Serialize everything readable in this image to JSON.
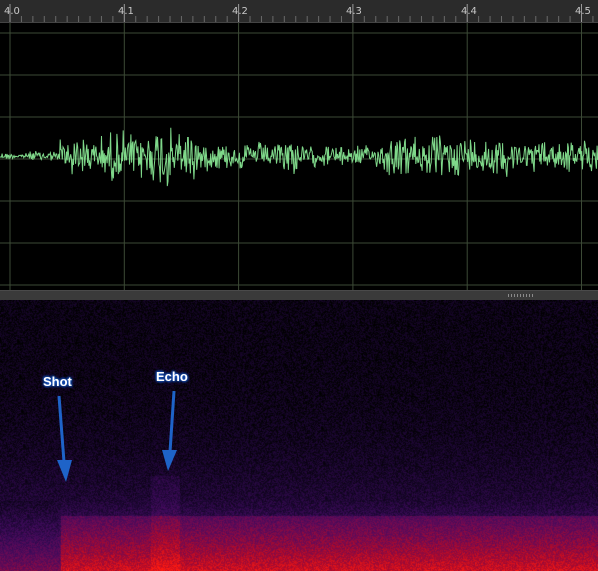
{
  "ruler": {
    "tick_labels": [
      "4.0",
      "4.1",
      "4.2",
      "4.3",
      "4.4",
      "4.5"
    ],
    "tick_values": [
      4.0,
      4.1,
      4.2,
      4.3,
      4.4,
      4.5
    ]
  },
  "waveform": {
    "color": "#7fd88a",
    "grid_color": "#3c4a36"
  },
  "spectrogram": {
    "colormap": [
      "#000000",
      "#1a0630",
      "#3d0a5a",
      "#6a0a55",
      "#b00a2a",
      "#ff1a10"
    ]
  },
  "annotations": {
    "shot_label": "Shot",
    "echo_label": "Echo",
    "arrow_color": "#1e63c8"
  }
}
